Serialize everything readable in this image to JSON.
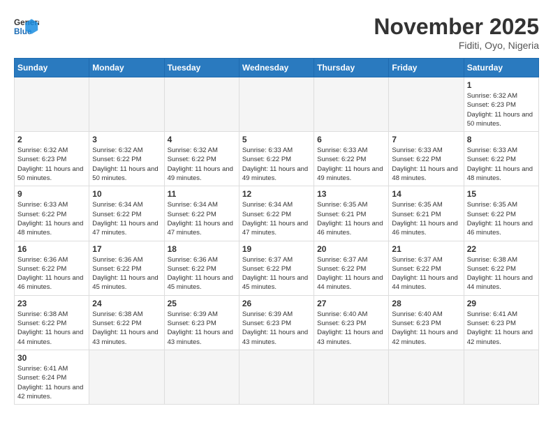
{
  "header": {
    "logo_general": "General",
    "logo_blue": "Blue",
    "month_title": "November 2025",
    "location": "Fiditi, Oyo, Nigeria"
  },
  "days_of_week": [
    "Sunday",
    "Monday",
    "Tuesday",
    "Wednesday",
    "Thursday",
    "Friday",
    "Saturday"
  ],
  "weeks": [
    [
      {
        "day": "",
        "empty": true
      },
      {
        "day": "",
        "empty": true
      },
      {
        "day": "",
        "empty": true
      },
      {
        "day": "",
        "empty": true
      },
      {
        "day": "",
        "empty": true
      },
      {
        "day": "",
        "empty": true
      },
      {
        "day": "1",
        "sunrise": "Sunrise: 6:32 AM",
        "sunset": "Sunset: 6:23 PM",
        "daylight": "Daylight: 11 hours and 50 minutes."
      }
    ],
    [
      {
        "day": "2",
        "sunrise": "Sunrise: 6:32 AM",
        "sunset": "Sunset: 6:23 PM",
        "daylight": "Daylight: 11 hours and 50 minutes."
      },
      {
        "day": "3",
        "sunrise": "Sunrise: 6:32 AM",
        "sunset": "Sunset: 6:22 PM",
        "daylight": "Daylight: 11 hours and 50 minutes."
      },
      {
        "day": "4",
        "sunrise": "Sunrise: 6:32 AM",
        "sunset": "Sunset: 6:22 PM",
        "daylight": "Daylight: 11 hours and 49 minutes."
      },
      {
        "day": "5",
        "sunrise": "Sunrise: 6:33 AM",
        "sunset": "Sunset: 6:22 PM",
        "daylight": "Daylight: 11 hours and 49 minutes."
      },
      {
        "day": "6",
        "sunrise": "Sunrise: 6:33 AM",
        "sunset": "Sunset: 6:22 PM",
        "daylight": "Daylight: 11 hours and 49 minutes."
      },
      {
        "day": "7",
        "sunrise": "Sunrise: 6:33 AM",
        "sunset": "Sunset: 6:22 PM",
        "daylight": "Daylight: 11 hours and 48 minutes."
      },
      {
        "day": "8",
        "sunrise": "Sunrise: 6:33 AM",
        "sunset": "Sunset: 6:22 PM",
        "daylight": "Daylight: 11 hours and 48 minutes."
      }
    ],
    [
      {
        "day": "9",
        "sunrise": "Sunrise: 6:33 AM",
        "sunset": "Sunset: 6:22 PM",
        "daylight": "Daylight: 11 hours and 48 minutes."
      },
      {
        "day": "10",
        "sunrise": "Sunrise: 6:34 AM",
        "sunset": "Sunset: 6:22 PM",
        "daylight": "Daylight: 11 hours and 47 minutes."
      },
      {
        "day": "11",
        "sunrise": "Sunrise: 6:34 AM",
        "sunset": "Sunset: 6:22 PM",
        "daylight": "Daylight: 11 hours and 47 minutes."
      },
      {
        "day": "12",
        "sunrise": "Sunrise: 6:34 AM",
        "sunset": "Sunset: 6:22 PM",
        "daylight": "Daylight: 11 hours and 47 minutes."
      },
      {
        "day": "13",
        "sunrise": "Sunrise: 6:35 AM",
        "sunset": "Sunset: 6:21 PM",
        "daylight": "Daylight: 11 hours and 46 minutes."
      },
      {
        "day": "14",
        "sunrise": "Sunrise: 6:35 AM",
        "sunset": "Sunset: 6:21 PM",
        "daylight": "Daylight: 11 hours and 46 minutes."
      },
      {
        "day": "15",
        "sunrise": "Sunrise: 6:35 AM",
        "sunset": "Sunset: 6:22 PM",
        "daylight": "Daylight: 11 hours and 46 minutes."
      }
    ],
    [
      {
        "day": "16",
        "sunrise": "Sunrise: 6:36 AM",
        "sunset": "Sunset: 6:22 PM",
        "daylight": "Daylight: 11 hours and 46 minutes."
      },
      {
        "day": "17",
        "sunrise": "Sunrise: 6:36 AM",
        "sunset": "Sunset: 6:22 PM",
        "daylight": "Daylight: 11 hours and 45 minutes."
      },
      {
        "day": "18",
        "sunrise": "Sunrise: 6:36 AM",
        "sunset": "Sunset: 6:22 PM",
        "daylight": "Daylight: 11 hours and 45 minutes."
      },
      {
        "day": "19",
        "sunrise": "Sunrise: 6:37 AM",
        "sunset": "Sunset: 6:22 PM",
        "daylight": "Daylight: 11 hours and 45 minutes."
      },
      {
        "day": "20",
        "sunrise": "Sunrise: 6:37 AM",
        "sunset": "Sunset: 6:22 PM",
        "daylight": "Daylight: 11 hours and 44 minutes."
      },
      {
        "day": "21",
        "sunrise": "Sunrise: 6:37 AM",
        "sunset": "Sunset: 6:22 PM",
        "daylight": "Daylight: 11 hours and 44 minutes."
      },
      {
        "day": "22",
        "sunrise": "Sunrise: 6:38 AM",
        "sunset": "Sunset: 6:22 PM",
        "daylight": "Daylight: 11 hours and 44 minutes."
      }
    ],
    [
      {
        "day": "23",
        "sunrise": "Sunrise: 6:38 AM",
        "sunset": "Sunset: 6:22 PM",
        "daylight": "Daylight: 11 hours and 44 minutes."
      },
      {
        "day": "24",
        "sunrise": "Sunrise: 6:38 AM",
        "sunset": "Sunset: 6:22 PM",
        "daylight": "Daylight: 11 hours and 43 minutes."
      },
      {
        "day": "25",
        "sunrise": "Sunrise: 6:39 AM",
        "sunset": "Sunset: 6:23 PM",
        "daylight": "Daylight: 11 hours and 43 minutes."
      },
      {
        "day": "26",
        "sunrise": "Sunrise: 6:39 AM",
        "sunset": "Sunset: 6:23 PM",
        "daylight": "Daylight: 11 hours and 43 minutes."
      },
      {
        "day": "27",
        "sunrise": "Sunrise: 6:40 AM",
        "sunset": "Sunset: 6:23 PM",
        "daylight": "Daylight: 11 hours and 43 minutes."
      },
      {
        "day": "28",
        "sunrise": "Sunrise: 6:40 AM",
        "sunset": "Sunset: 6:23 PM",
        "daylight": "Daylight: 11 hours and 42 minutes."
      },
      {
        "day": "29",
        "sunrise": "Sunrise: 6:41 AM",
        "sunset": "Sunset: 6:23 PM",
        "daylight": "Daylight: 11 hours and 42 minutes."
      }
    ],
    [
      {
        "day": "30",
        "sunrise": "Sunrise: 6:41 AM",
        "sunset": "Sunset: 6:24 PM",
        "daylight": "Daylight: 11 hours and 42 minutes."
      },
      {
        "day": "",
        "empty": true
      },
      {
        "day": "",
        "empty": true
      },
      {
        "day": "",
        "empty": true
      },
      {
        "day": "",
        "empty": true
      },
      {
        "day": "",
        "empty": true
      },
      {
        "day": "",
        "empty": true
      }
    ]
  ]
}
